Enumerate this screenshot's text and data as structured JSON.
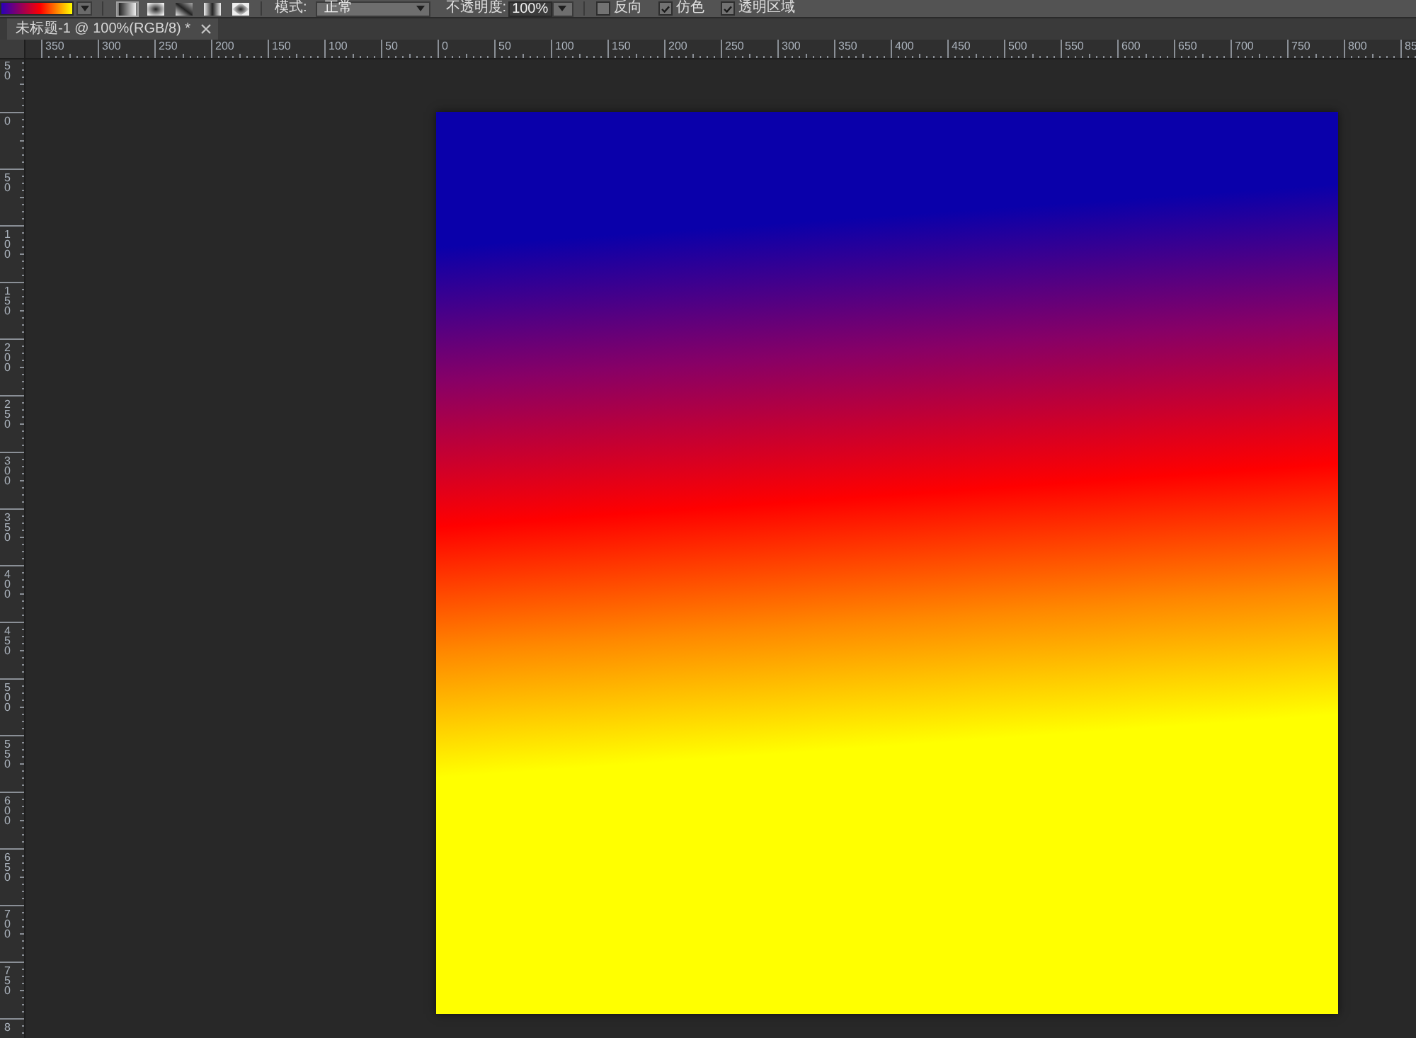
{
  "options_bar": {
    "gradient_types": [
      {
        "selected": true
      },
      {
        "selected": false
      },
      {
        "selected": false
      },
      {
        "selected": false
      },
      {
        "selected": false
      }
    ],
    "mode": {
      "label": "模式:",
      "value": "正常"
    },
    "opacity": {
      "label": "不透明度:",
      "value": "100%"
    },
    "checkboxes": [
      {
        "label": "反向",
        "checked": false
      },
      {
        "label": "仿色",
        "checked": true
      },
      {
        "label": "透明区域",
        "checked": true
      }
    ]
  },
  "document_tabs": [
    {
      "title": "未标题-1 @ 100%(RGB/8) *",
      "selected": true
    }
  ],
  "rulers": {
    "horizontal": [
      "350",
      "300",
      "250",
      "200",
      "150",
      "100",
      "50",
      "0",
      "50",
      "100",
      "150",
      "200",
      "250",
      "300",
      "350",
      "400",
      "450",
      "500",
      "550",
      "600",
      "650",
      "700",
      "750",
      "800",
      "85"
    ],
    "vertical": [
      "50",
      "0",
      "50",
      "100",
      "150",
      "200",
      "250",
      "300",
      "350",
      "400",
      "450",
      "500",
      "550",
      "600",
      "650",
      "700",
      "750",
      "8"
    ]
  }
}
